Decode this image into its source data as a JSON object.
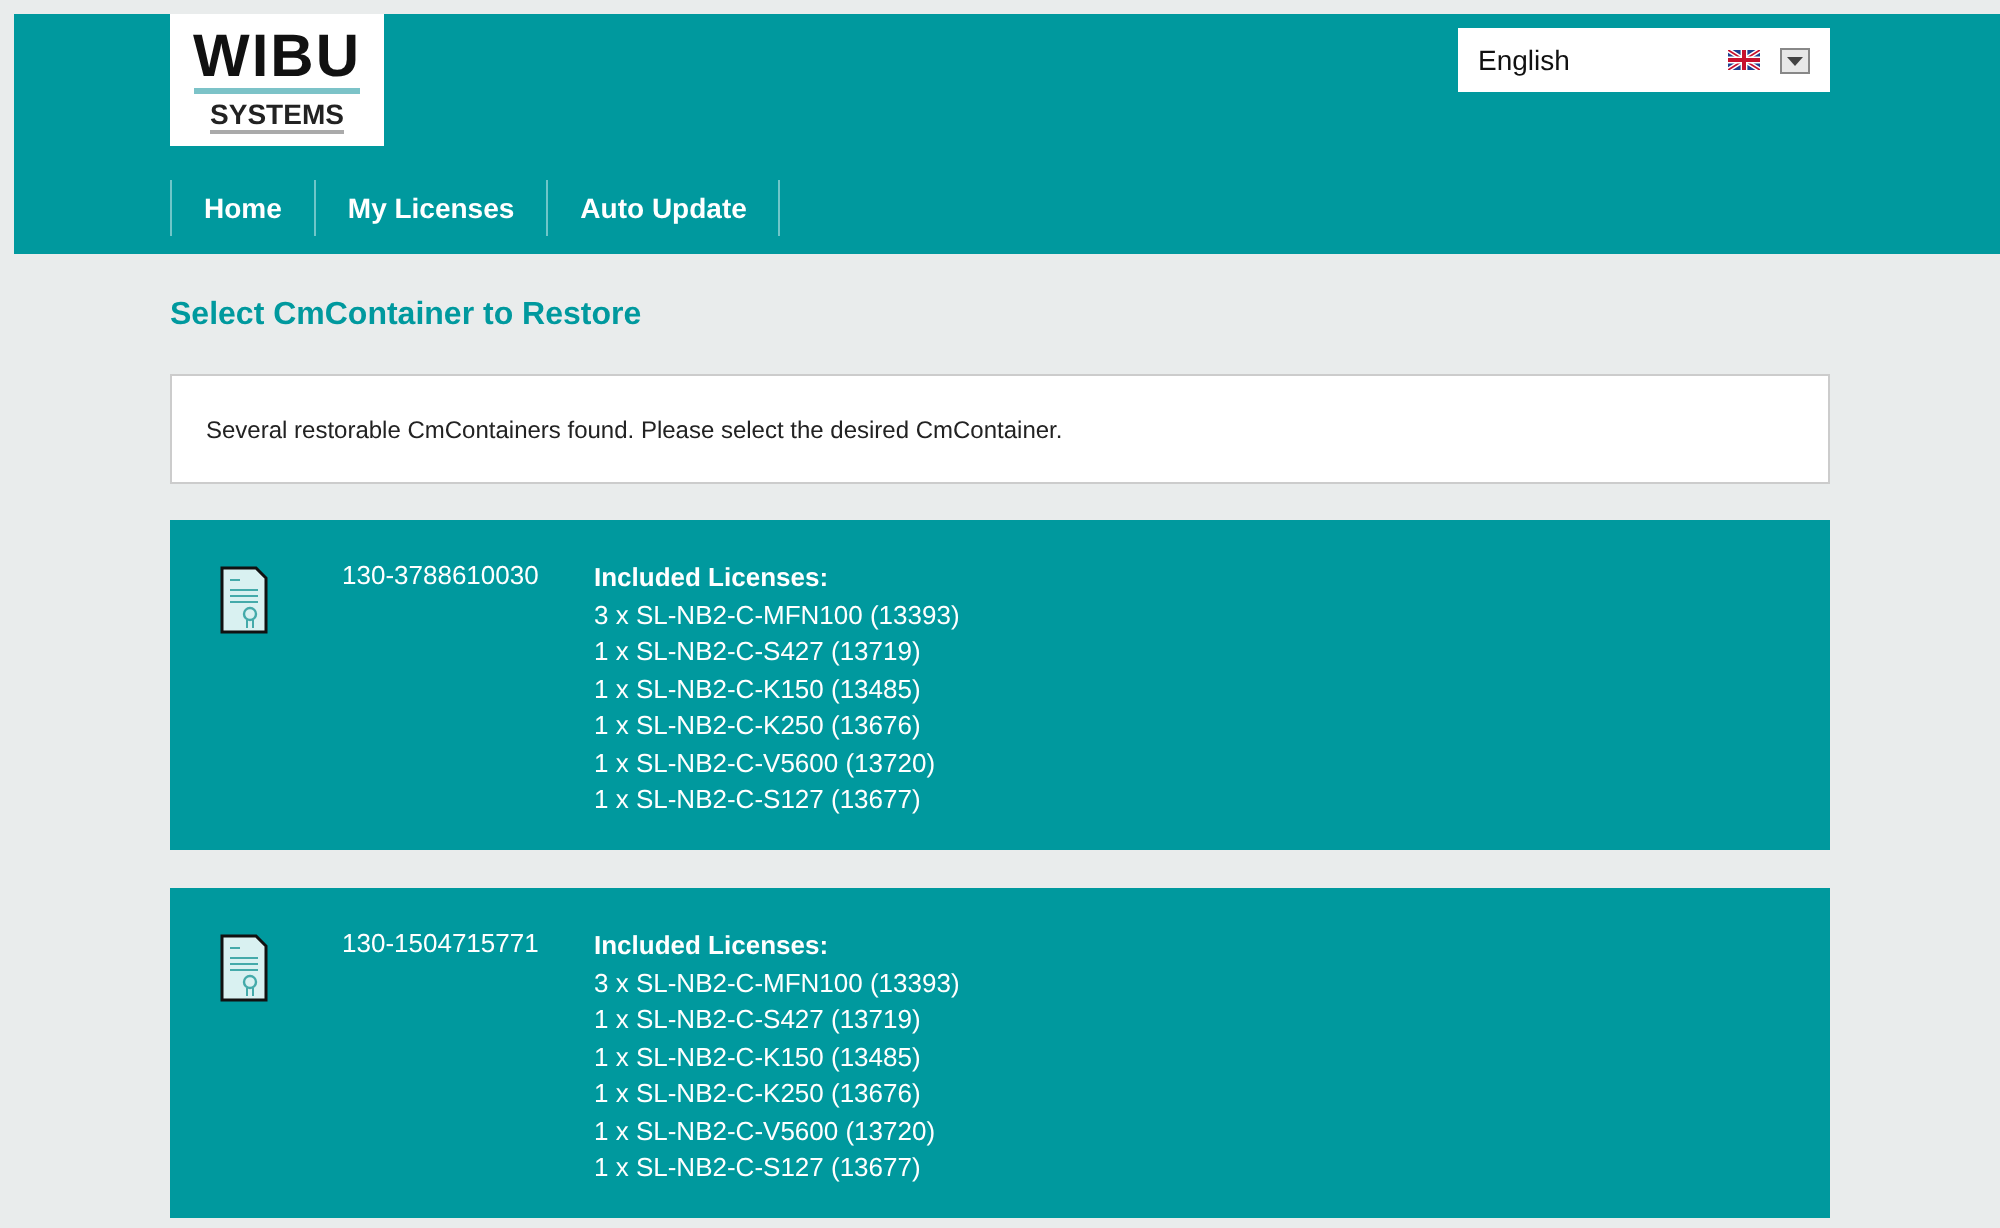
{
  "logo": {
    "top": "WIBU",
    "bottom": "SYSTEMS"
  },
  "language": {
    "value": "English"
  },
  "nav": [
    {
      "label": "Home"
    },
    {
      "label": "My Licenses"
    },
    {
      "label": "Auto Update"
    }
  ],
  "heading": "Select CmContainer to Restore",
  "message": "Several restorable CmContainers found. Please select the desired CmContainer.",
  "containers": [
    {
      "serial": "130-3788610030",
      "licenses_title": "Included Licenses:",
      "licenses": [
        "3 x SL-NB2-C-MFN100 (13393)",
        "1 x SL-NB2-C-S427 (13719)",
        "1 x SL-NB2-C-K150 (13485)",
        "1 x SL-NB2-C-K250 (13676)",
        "1 x SL-NB2-C-V5600 (13720)",
        "1 x SL-NB2-C-S127 (13677)"
      ]
    },
    {
      "serial": "130-1504715771",
      "licenses_title": "Included Licenses:",
      "licenses": [
        "3 x SL-NB2-C-MFN100 (13393)",
        "1 x SL-NB2-C-S427 (13719)",
        "1 x SL-NB2-C-K150 (13485)",
        "1 x SL-NB2-C-K250 (13676)",
        "1 x SL-NB2-C-V5600 (13720)",
        "1 x SL-NB2-C-S127 (13677)"
      ]
    }
  ]
}
